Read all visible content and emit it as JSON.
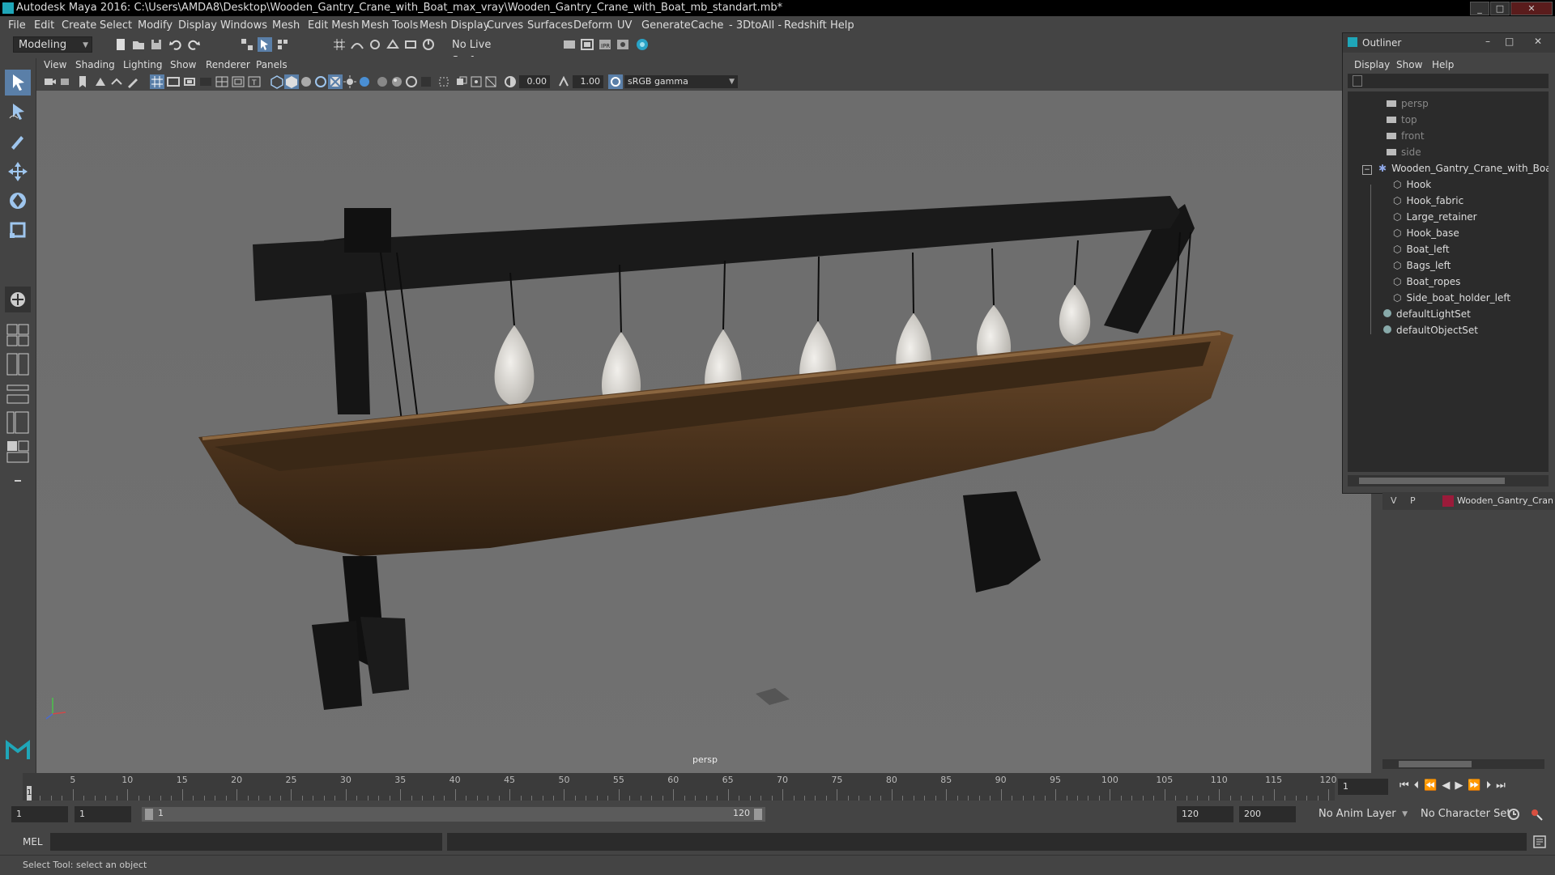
{
  "window": {
    "title": "Autodesk Maya 2016: C:\\Users\\AMDA8\\Desktop\\Wooden_Gantry_Crane_with_Boat_max_vray\\Wooden_Gantry_Crane_with_Boat_mb_standart.mb*"
  },
  "menubar": [
    "File",
    "Edit",
    "Create",
    "Select",
    "Modify",
    "Display",
    "Windows",
    "Mesh",
    "Edit Mesh",
    "Mesh Tools",
    "Mesh Display",
    "Curves",
    "Surfaces",
    "Deform",
    "UV",
    "Generate",
    "Cache",
    "- 3DtoAll -",
    "Redshift",
    "Help"
  ],
  "shelf": {
    "mode": "Modeling",
    "live_surface": "No Live Surface"
  },
  "viewport": {
    "menu": [
      "View",
      "Shading",
      "Lighting",
      "Show",
      "Renderer",
      "Panels"
    ],
    "exposure": "0.00",
    "gamma": "1.00",
    "color_space": "sRGB gamma",
    "camera_label": "persp"
  },
  "outliner": {
    "title": "Outliner",
    "menu": [
      "Display",
      "Show",
      "Help"
    ],
    "cameras": [
      "persp",
      "top",
      "front",
      "side"
    ],
    "root": "Wooden_Gantry_Crane_with_Boat_",
    "children": [
      "Hook",
      "Hook_fabric",
      "Large_retainer",
      "Hook_base",
      "Boat_left",
      "Bags_left",
      "Boat_ropes",
      "Side_boat_holder_left"
    ],
    "sets": [
      "defaultLightSet",
      "defaultObjectSet"
    ]
  },
  "layer": {
    "v": "V",
    "p": "P",
    "name": "Wooden_Gantry_Cran"
  },
  "timeline": {
    "ticks": [
      "5",
      "10",
      "15",
      "20",
      "25",
      "30",
      "35",
      "40",
      "45",
      "50",
      "55",
      "60",
      "65",
      "70",
      "75",
      "80",
      "85",
      "90",
      "95",
      "100",
      "105",
      "110",
      "115",
      "120"
    ],
    "current_marker": "1",
    "current_frame": "1"
  },
  "range": {
    "start": "1",
    "playback_start": "1",
    "slider_start": "1",
    "slider_end": "120",
    "playback_end": "120",
    "end": "200",
    "anim_layer": "No Anim Layer",
    "character_set": "No Character Set"
  },
  "command": {
    "language": "MEL"
  },
  "help": {
    "text": "Select Tool: select an object"
  },
  "colors": {
    "accent": "#1fa6b8",
    "layer_color": "#9b1b3a"
  }
}
